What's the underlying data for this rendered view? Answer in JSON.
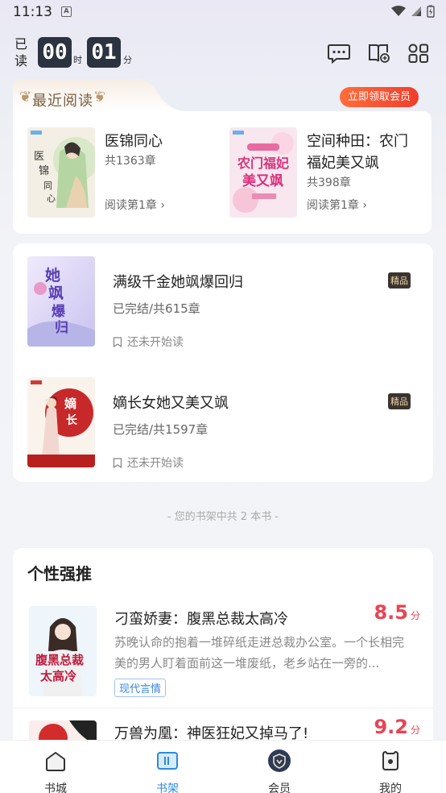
{
  "status_bar": {
    "time": "11:13",
    "a_label": "A"
  },
  "header": {
    "read_label": "已读",
    "hours": "00",
    "hours_unit": "时",
    "minutes": "01",
    "minutes_unit": "分",
    "icons": [
      "message-icon",
      "book-add-icon",
      "apps-grid-icon"
    ]
  },
  "recent": {
    "title": "最近阅读",
    "vip_button": "立即领取会员",
    "books": [
      {
        "title": "医锦同心",
        "chapters": "共1363章",
        "progress": "阅读第1章 ›"
      },
      {
        "title": "空间种田：农门福妃美又飒",
        "chapters": "共398章",
        "progress": "阅读第1章 ›"
      }
    ]
  },
  "shelf": {
    "books": [
      {
        "title": "满级千金她飒爆回归",
        "status": "已完结/共615章",
        "note": "还未开始读",
        "badge": "精品"
      },
      {
        "title": "嫡长女她又美又飒",
        "status": "已完结/共1597章",
        "note": "还未开始读",
        "badge": "精品"
      }
    ],
    "footer": "- 您的书架中共 2 本书 -"
  },
  "recommend": {
    "title": "个性强推",
    "books": [
      {
        "title": "刁蛮娇妻：腹黑总裁太高冷",
        "score": "8.5",
        "score_unit": "分",
        "desc": "苏晚认命的抱着一堆碎纸走进总裁办公室。一个长相完美的男人盯着面前这一堆废纸，老乡站在一旁的...",
        "tag": "现代言情"
      },
      {
        "title": "万兽为凰：神医狂妃又掉马了!",
        "score": "9.2",
        "score_unit": "分"
      }
    ]
  },
  "tabs": [
    {
      "label": "书城"
    },
    {
      "label": "书架"
    },
    {
      "label": "会员"
    },
    {
      "label": "我的"
    }
  ],
  "colors": {
    "accent": "#2b8be0",
    "score": "#e94453",
    "vip_start": "#ff6d3a",
    "vip_end": "#f03d2c"
  }
}
